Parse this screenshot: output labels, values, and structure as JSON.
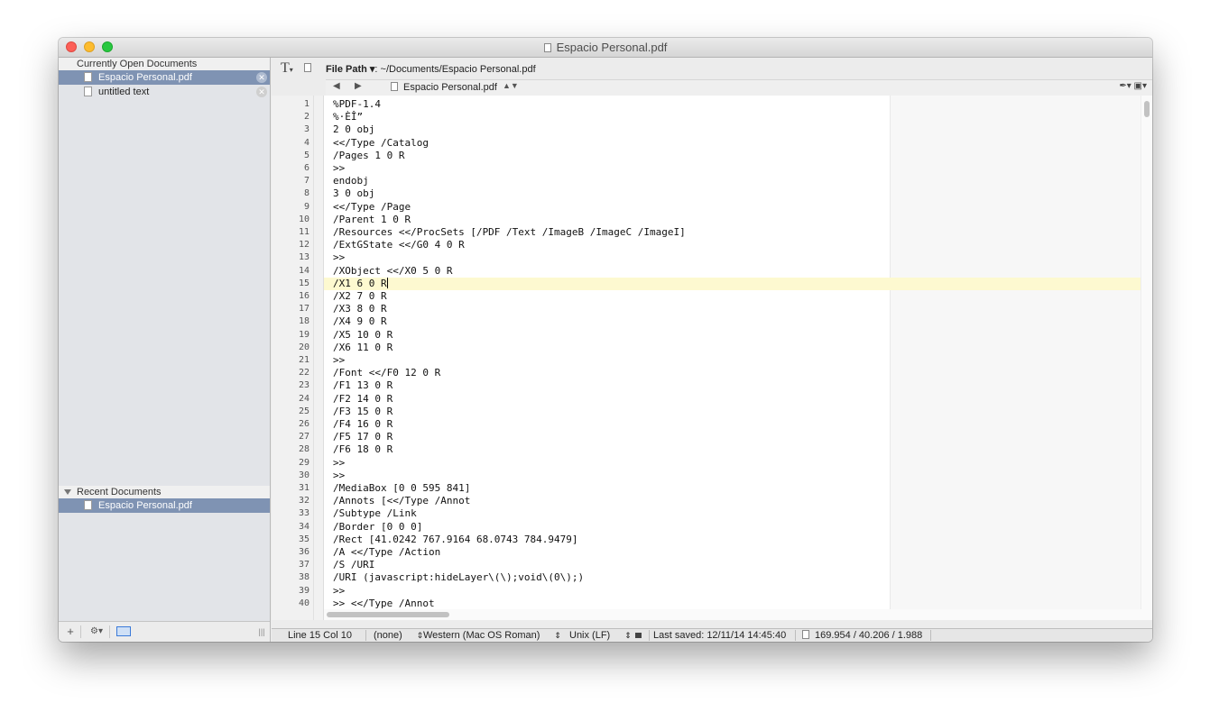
{
  "window": {
    "title": "Espacio Personal.pdf"
  },
  "sidebar": {
    "open_header": "Currently Open Documents",
    "open_docs": [
      {
        "label": "Espacio Personal.pdf",
        "selected": true
      },
      {
        "label": "untitled text",
        "selected": false
      }
    ],
    "recent_header": "Recent Documents",
    "recent_docs": [
      {
        "label": "Espacio Personal.pdf",
        "selected": true
      }
    ],
    "bottom": {
      "add": "+",
      "action": "⚙▾",
      "divider": "|||"
    }
  },
  "toolbar": {
    "text_tool": "T",
    "filepath_label": "File Path",
    "filepath_value": ": ~/Documents/Espacio Personal.pdf"
  },
  "navbar": {
    "back": "◀",
    "forward": "▶",
    "doc_name": "Espacio Personal.pdf",
    "updown": "▲▼",
    "right_tools": "✒▾ ▣▾"
  },
  "editor": {
    "current_line": 15,
    "lines": [
      "%PDF-1.4",
      "%·ÈÎ”",
      "2 0 obj",
      "<</Type /Catalog",
      "/Pages 1 0 R",
      ">>",
      "endobj",
      "3 0 obj",
      "<</Type /Page",
      "/Parent 1 0 R",
      "/Resources <</ProcSets [/PDF /Text /ImageB /ImageC /ImageI]",
      "/ExtGState <</G0 4 0 R",
      ">>",
      "/XObject <</X0 5 0 R",
      "/X1 6 0 R",
      "/X2 7 0 R",
      "/X3 8 0 R",
      "/X4 9 0 R",
      "/X5 10 0 R",
      "/X6 11 0 R",
      ">>",
      "/Font <</F0 12 0 R",
      "/F1 13 0 R",
      "/F2 14 0 R",
      "/F3 15 0 R",
      "/F4 16 0 R",
      "/F5 17 0 R",
      "/F6 18 0 R",
      ">>",
      ">>",
      "/MediaBox [0 0 595 841]",
      "/Annots [<</Type /Annot",
      "/Subtype /Link",
      "/Border [0 0 0]",
      "/Rect [41.0242 767.9164 68.0743 784.9479]",
      "/A <</Type /Action",
      "/S /URI",
      "/URI (javascript:hideLayer\\(\\);void\\(0\\);)",
      ">>",
      ">> <</Type /Annot"
    ]
  },
  "status": {
    "position": "Line 15 Col 10",
    "syntax": "(none)",
    "encoding": "Western (Mac OS Roman)",
    "line_endings": "Unix (LF)",
    "last_saved": "Last saved: 12/11/14 14:45:40",
    "stats": "169.954 / 40.206 / 1.988"
  }
}
